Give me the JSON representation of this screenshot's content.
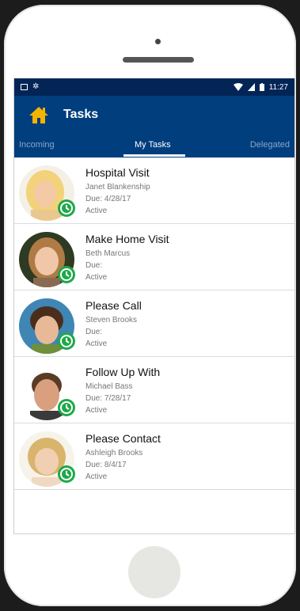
{
  "statusbar": {
    "time": "11:27"
  },
  "appbar": {
    "title": "Tasks"
  },
  "tabs": [
    {
      "label": "Incoming"
    },
    {
      "label": "My Tasks"
    },
    {
      "label": "Delegated"
    }
  ],
  "tasks": [
    {
      "title": "Hospital Visit",
      "person": "Janet Blankenship",
      "due": "Due: 4/28/17",
      "status": "Active"
    },
    {
      "title": "Make Home Visit",
      "person": "Beth Marcus",
      "due": "Due:",
      "status": "Active"
    },
    {
      "title": "Please Call",
      "person": "Steven Brooks",
      "due": "Due:",
      "status": "Active"
    },
    {
      "title": "Follow Up With",
      "person": "Michael Bass",
      "due": "Due: 7/28/17",
      "status": "Active"
    },
    {
      "title": "Please Contact",
      "person": "Ashleigh Brooks",
      "due": "Due: 8/4/17",
      "status": "Active"
    }
  ],
  "colors": {
    "status_bar": "#022556",
    "app_bar": "#003e7e",
    "clock_badge": "#1fa84a",
    "home_icon": "#f4b400"
  },
  "icons": [
    "home-icon",
    "clock-icon",
    "wifi-icon",
    "signal-icon",
    "battery-icon"
  ]
}
